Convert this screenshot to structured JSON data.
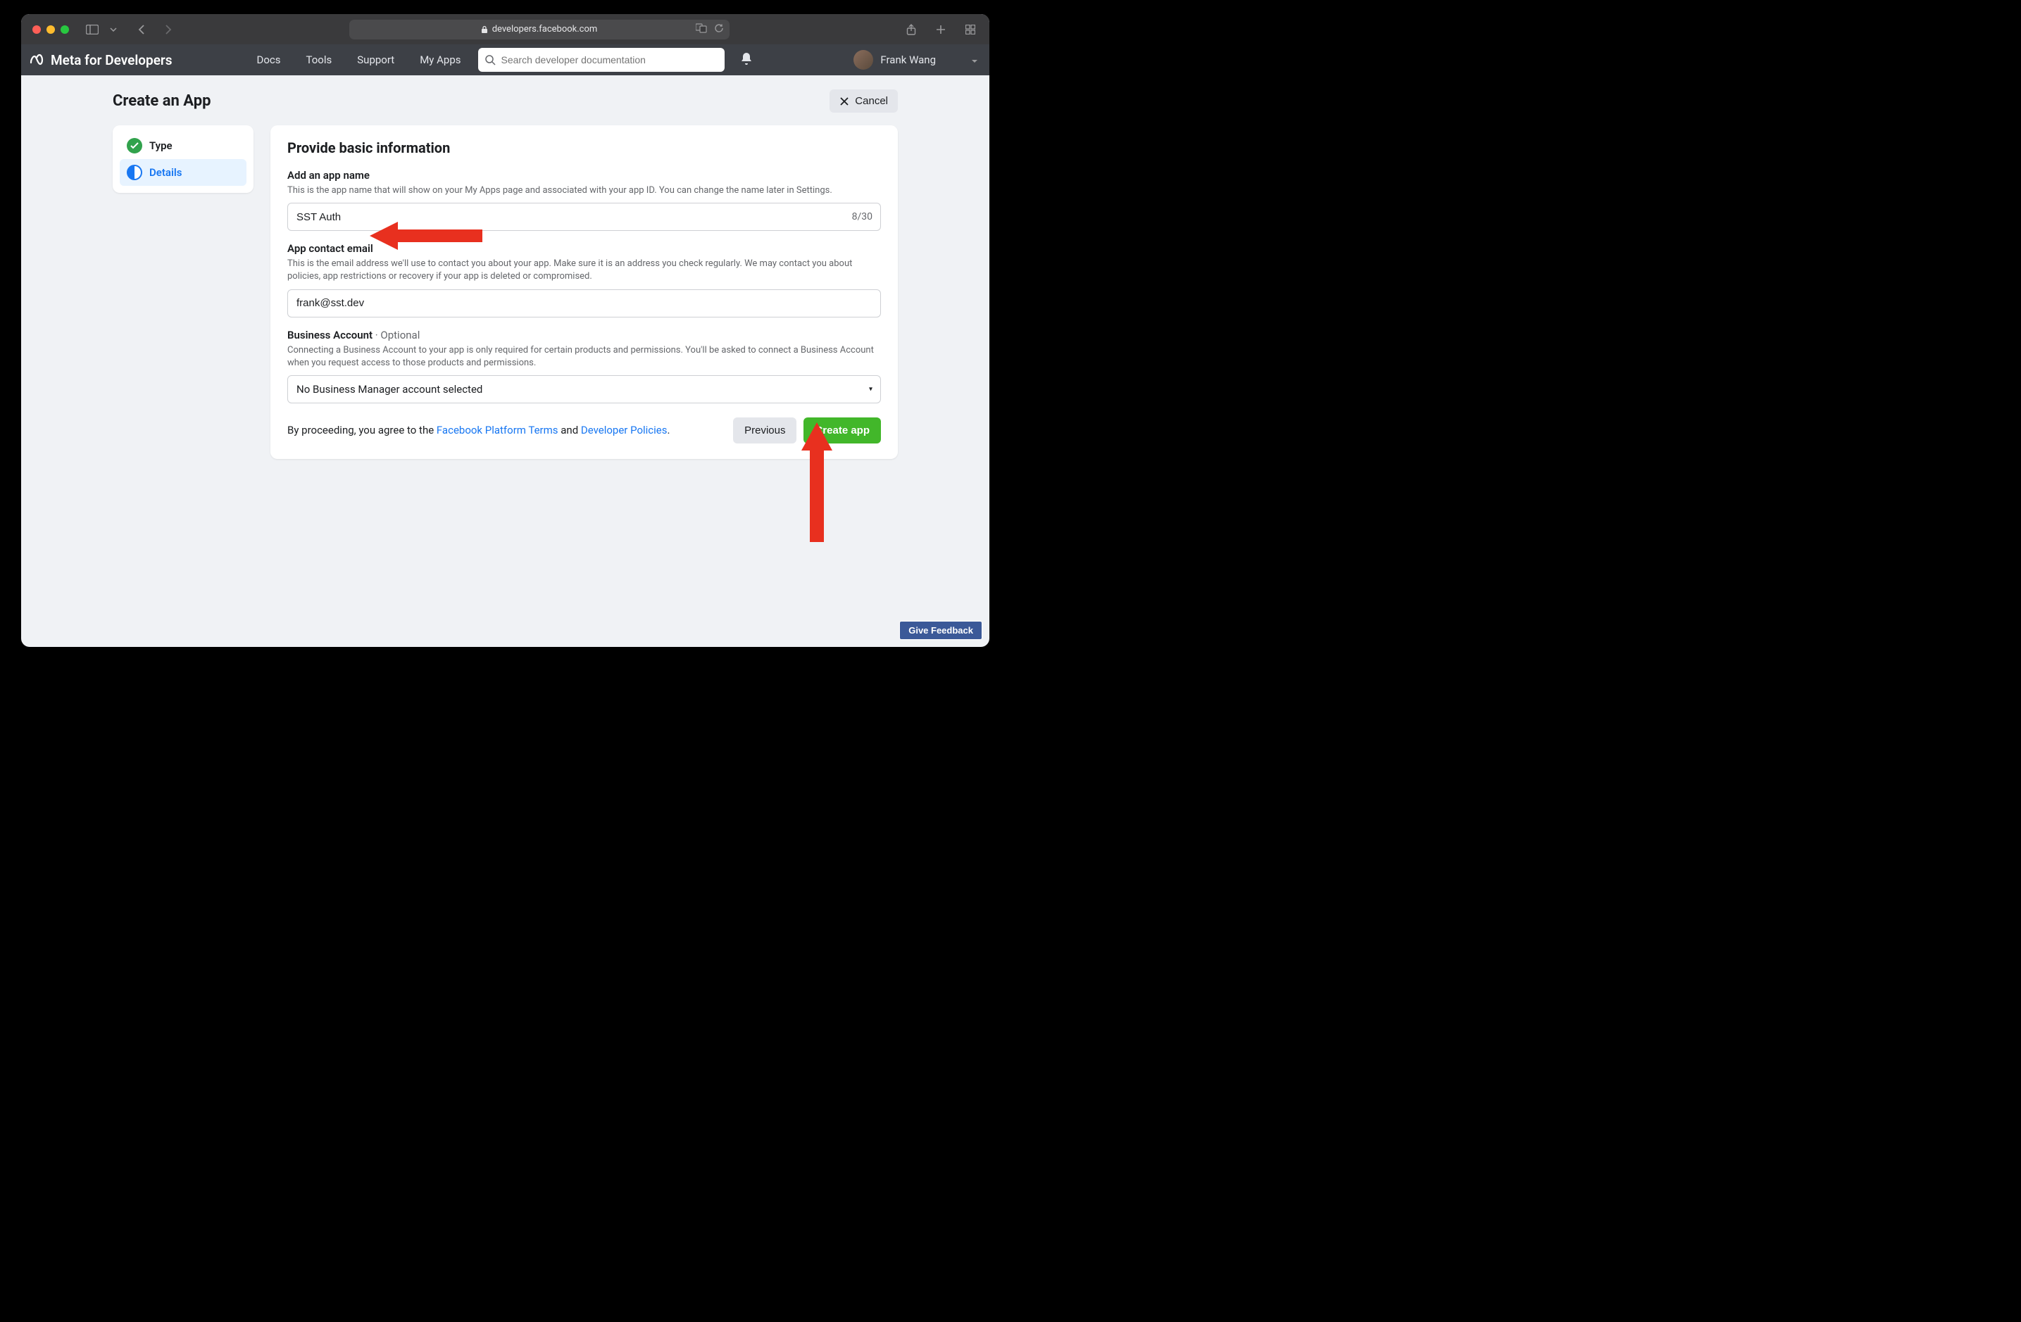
{
  "browser": {
    "url": "developers.facebook.com"
  },
  "nav": {
    "brand": "Meta for Developers",
    "links": {
      "docs": "Docs",
      "tools": "Tools",
      "support": "Support",
      "myapps": "My Apps"
    },
    "search_placeholder": "Search developer documentation",
    "user_name": "Frank Wang"
  },
  "page": {
    "title": "Create an App",
    "cancel_label": "Cancel"
  },
  "sidebar": {
    "type_label": "Type",
    "details_label": "Details"
  },
  "form": {
    "title": "Provide basic information",
    "app_name": {
      "label": "Add an app name",
      "desc": "This is the app name that will show on your My Apps page and associated with your app ID. You can change the name later in Settings.",
      "value": "SST Auth",
      "char_count": "8/30"
    },
    "contact_email": {
      "label": "App contact email",
      "desc": "This is the email address we'll use to contact you about your app. Make sure it is an address you check regularly. We may contact you about policies, app restrictions or recovery if your app is deleted or compromised.",
      "value": "frank@sst.dev"
    },
    "business": {
      "label": "Business Account",
      "optional": " · Optional",
      "desc": "Connecting a Business Account to your app is only required for certain products and permissions. You'll be asked to connect a Business Account when you request access to those products and permissions.",
      "value": "No Business Manager account selected"
    },
    "agree": {
      "prefix": "By proceeding, you agree to the ",
      "terms": "Facebook Platform Terms",
      "and": " and ",
      "policies": "Developer Policies",
      "dot": "."
    },
    "previous_label": "Previous",
    "create_label": "Create app"
  },
  "feedback_label": "Give Feedback"
}
